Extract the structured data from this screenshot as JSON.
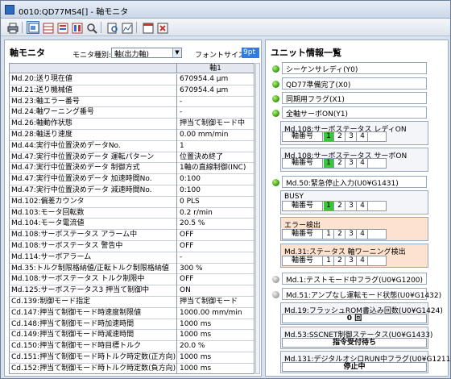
{
  "window": {
    "title": "0010:QD77MS4[] - 軸モニタ"
  },
  "left": {
    "heading": "軸モニタ",
    "monitor_type_label": "モニタ種別:",
    "monitor_type_value": "軸(出力軸)",
    "font_size_label": "フォントサイズ:",
    "font_size_value": "9pt",
    "table": {
      "columns": [
        "",
        "軸1"
      ],
      "rows": [
        {
          "name": "Md.20:送り現在値",
          "value": "670954.4 μm"
        },
        {
          "name": "Md.21:送り機械値",
          "value": "670954.4 μm"
        },
        {
          "name": "Md.23:軸エラー番号",
          "value": "-"
        },
        {
          "name": "Md.24:軸ワーニング番号",
          "value": "-"
        },
        {
          "name": "Md.26:軸動作状態",
          "value": "押当て制御モード中"
        },
        {
          "name": "Md.28:軸送り速度",
          "value": "0.00 mm/min"
        },
        {
          "name": "Md.44:実行中位置決めデータNo.",
          "value": "1"
        },
        {
          "name": "Md.47:実行中位置決めデータ 運転パターン",
          "value": "位置決め終了"
        },
        {
          "name": "Md.47:実行中位置決めデータ 制御方式",
          "value": "1軸の直線制御(INC)"
        },
        {
          "name": "Md.47:実行中位置決めデータ 加速時間No.",
          "value": "0:100"
        },
        {
          "name": "Md.47:実行中位置決めデータ 減速時間No.",
          "value": "0:100"
        },
        {
          "name": "Md.102:偏差カウンタ",
          "value": "0 PLS"
        },
        {
          "name": "Md.103:モータ回転数",
          "value": "0.2 r/min"
        },
        {
          "name": "Md.104:モータ電流値",
          "value": "20.5 %"
        },
        {
          "name": "Md.108:サーボステータス アラーム中",
          "value": "OFF"
        },
        {
          "name": "Md.108:サーボステータス 警告中",
          "value": "OFF"
        },
        {
          "name": "Md.114:サーボアラーム",
          "value": "-"
        },
        {
          "name": "Md.35:トルク制限格納値/正転トルク制限格納値",
          "value": "300 %"
        },
        {
          "name": "Md.108:サーボステータス トルク制限中",
          "value": "OFF"
        },
        {
          "name": "Md.125:サーボステータス3 押当て制御中",
          "value": "ON"
        },
        {
          "name": "Cd.139:制御モード指定",
          "value": "押当て制御モード"
        },
        {
          "name": "Cd.147:押当て制御モード時速度制限値",
          "value": "1000.00 mm/min"
        },
        {
          "name": "Cd.148:押当て制御モード時加速時間",
          "value": "1000 ms"
        },
        {
          "name": "Cd.149:押当て制御モード時減速時間",
          "value": "1000 ms"
        },
        {
          "name": "Cd.150:押当て制御モード時目標トルク",
          "value": "20.0 %"
        },
        {
          "name": "Cd.151:押当て制御モード時トルク時定数(正方向)",
          "value": "1000 ms"
        },
        {
          "name": "Cd.152:押当て制御モード時トルク時定数(負方向)",
          "value": "1000 ms"
        }
      ]
    }
  },
  "right": {
    "heading": "ユニット情報一覧",
    "leds": [
      {
        "label": "シーケンサレディ(Y0)",
        "state": "on"
      },
      {
        "label": "QD77準備完了(X0)",
        "state": "on"
      },
      {
        "label": "同期用フラグ(X1)",
        "state": "on"
      },
      {
        "label": "全軸サーボON(Y1)",
        "state": "on"
      }
    ],
    "axis_label": "軸番号",
    "axis_numbers": [
      "1",
      "2",
      "3",
      "4"
    ],
    "servo_ready": {
      "title": "Md.108:サーボステータス レディON",
      "active": [
        true,
        false,
        false,
        false
      ]
    },
    "servo_on": {
      "title": "Md.108:サーボステータス サーボON",
      "active": [
        true,
        false,
        false,
        false
      ]
    },
    "emergency_stop": {
      "label": "Md.50:緊急停止入力(U0¥G1431)",
      "state": "on"
    },
    "busy": {
      "title": "BUSY",
      "active": [
        true,
        false,
        false,
        false
      ]
    },
    "error": {
      "title": "エラー検出",
      "active": [
        false,
        false,
        false,
        false
      ]
    },
    "warning": {
      "title": "Md.31:ステータス 軸ワーニング検出",
      "active": [
        false,
        false,
        false,
        false
      ]
    },
    "test_mode": {
      "label": "Md.1:テストモード中フラグ(U0¥G1200)",
      "state": "off"
    },
    "analog": {
      "label": "Md.51:アンプなし運転モード状態(U0¥G1432)",
      "state": "off"
    },
    "flash": {
      "title": "Md.19:フラッシュROM書込み回数(U0¥G1424)",
      "value": "0 回"
    },
    "sscnet": {
      "title": "Md.53:SSCNET制御ステータス(U0¥G1433)",
      "value": "指令受付待ち"
    },
    "oscillo": {
      "title": "Md.131:デジタルオシロRUN中フラグ(U0¥G1211)",
      "value": "停止中"
    }
  }
}
